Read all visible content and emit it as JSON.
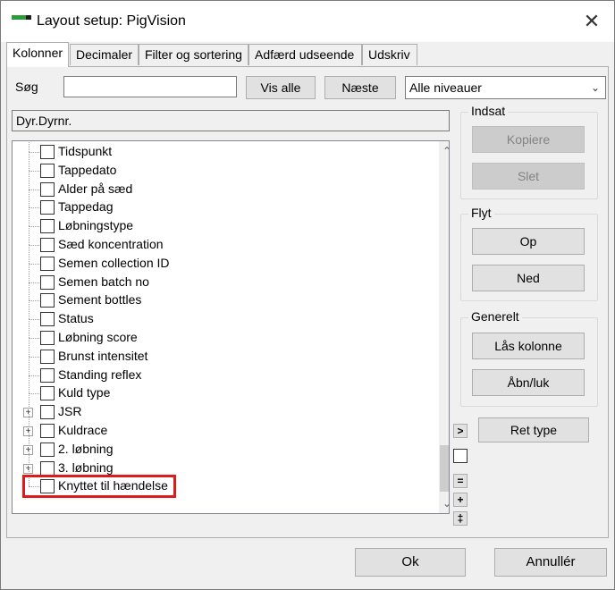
{
  "window": {
    "title": "Layout setup: PigVision",
    "close_glyph": "✕"
  },
  "tabs": [
    {
      "label": "Kolonner",
      "active": true
    },
    {
      "label": "Decimaler",
      "active": false
    },
    {
      "label": "Filter og sortering",
      "active": false
    },
    {
      "label": "Adfærd  udseende",
      "active": false
    },
    {
      "label": "Udskriv",
      "active": false
    }
  ],
  "search": {
    "label": "Søg",
    "value": "",
    "show_all_label": "Vis alle",
    "next_label": "Næste",
    "level_select": "Alle niveauer"
  },
  "current_column": "Dyr.Dyrnr.",
  "tree_items": [
    {
      "label": "Tidspunkt",
      "expandable": false
    },
    {
      "label": "Tappedato",
      "expandable": false
    },
    {
      "label": "Alder på sæd",
      "expandable": false
    },
    {
      "label": "Tappedag",
      "expandable": false
    },
    {
      "label": "Løbningstype",
      "expandable": false
    },
    {
      "label": "Sæd koncentration",
      "expandable": false
    },
    {
      "label": "Semen collection ID",
      "expandable": false
    },
    {
      "label": "Semen batch no",
      "expandable": false
    },
    {
      "label": "Sement bottles",
      "expandable": false
    },
    {
      "label": "Status",
      "expandable": false
    },
    {
      "label": "Løbning score",
      "expandable": false
    },
    {
      "label": "Brunst intensitet",
      "expandable": false
    },
    {
      "label": "Standing reflex",
      "expandable": false
    },
    {
      "label": "Kuld type",
      "expandable": false
    },
    {
      "label": "JSR",
      "expandable": true
    },
    {
      "label": "Kuldrace",
      "expandable": true
    },
    {
      "label": "2. løbning",
      "expandable": true
    },
    {
      "label": "3. løbning",
      "expandable": true
    },
    {
      "label": "Knyttet til hændelse",
      "expandable": false
    }
  ],
  "groups": {
    "indsat": {
      "title": "Indsat",
      "copy_label": "Kopiere",
      "delete_label": "Slet"
    },
    "flyt": {
      "title": "Flyt",
      "up_label": "Op",
      "down_label": "Ned"
    },
    "generelt": {
      "title": "Generelt",
      "lock_label": "Lås kolonne",
      "toggle_label": "Åbn/luk"
    }
  },
  "side_controls": {
    "arrow_glyph": ">",
    "equal_glyph": "=",
    "plus_glyph": "+",
    "plusminus_glyph": "‡",
    "change_type_label": "Ret type"
  },
  "footer": {
    "ok_label": "Ok",
    "cancel_label": "Annullér"
  },
  "colors": {
    "highlight": "#e01a1a",
    "app_icon": "#2e9b3a"
  }
}
